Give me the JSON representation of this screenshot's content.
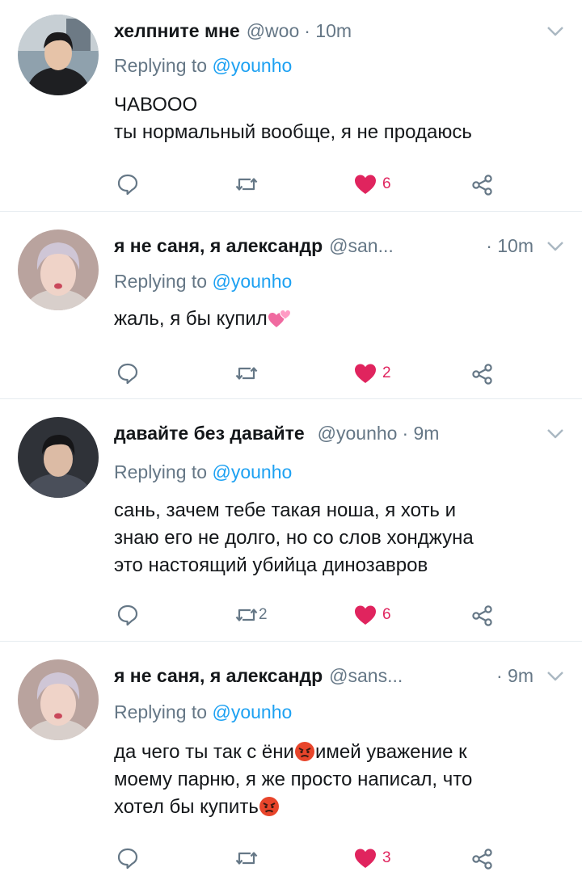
{
  "colors": {
    "text": "#14171a",
    "muted": "#657786",
    "link": "#1da1f2",
    "like": "#e0245e",
    "divider": "#e6ecf0"
  },
  "tweets": [
    {
      "name": "хелпните мне",
      "handle": "@woo",
      "time": "· 10m",
      "reply_prefix": "Replying to",
      "reply_to": "@younho",
      "lines": [
        "ЧАВООО",
        "ты нормальный вообще, я не продаюсь"
      ],
      "retweets": "",
      "likes": "6"
    },
    {
      "name": "я не саня, я александр",
      "handle": "@san...",
      "time": "· 10m",
      "reply_prefix": "Replying to",
      "reply_to": "@younho",
      "text": "жаль, я бы купил",
      "emoji": "two-hearts-emoji",
      "retweets": "",
      "likes": "2"
    },
    {
      "name": "давайте без давайте",
      "handle": "@younho",
      "time": "· 9m",
      "reply_prefix": "Replying to",
      "reply_to": "@younho",
      "lines": [
        "сань, зачем тебе такая ноша, я хоть и",
        "знаю его не долго, но со слов хонджуна",
        "это настоящий убийца динозавров"
      ],
      "retweets": "2",
      "likes": "6"
    },
    {
      "name": "я не саня, я александр",
      "handle": "@sans...",
      "time": "· 9m",
      "reply_prefix": "Replying to",
      "reply_to": "@younho",
      "line1_a": "да чего ты так с ёни",
      "line1_b": "имей уважение к",
      "line2": "моему парню, я же просто написал, что",
      "line3": "хотел бы купить",
      "emoji": "angry-face-emoji",
      "retweets": "",
      "likes": "3"
    }
  ]
}
